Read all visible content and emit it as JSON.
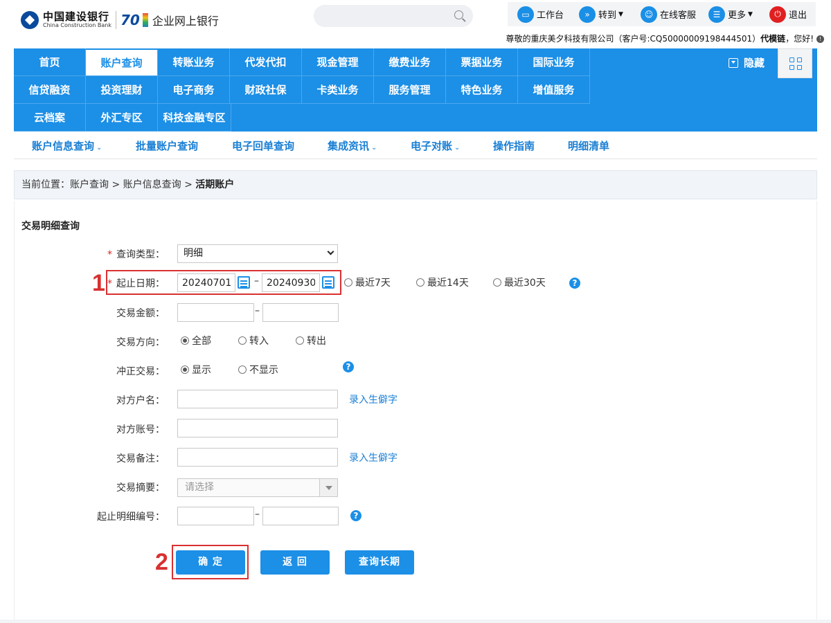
{
  "header": {
    "logo_cn": "中国建设银行",
    "logo_en": "China Construction Bank",
    "logo_badge": "70",
    "product_name": "企业网上银行",
    "search_placeholder": "",
    "tools": [
      {
        "label": "工作台",
        "icon": "monitor-icon"
      },
      {
        "label": "转到",
        "icon": "forward-icon"
      },
      {
        "label": "在线客服",
        "icon": "user-icon"
      },
      {
        "label": "更多",
        "icon": "list-icon"
      },
      {
        "label": "退出",
        "icon": "power-icon"
      }
    ],
    "welcome_prefix": "尊敬的重庆美夕科技有限公司（客户号:CQ50000009198444501）",
    "welcome_name": "代模链",
    "welcome_suffix": "，您好!"
  },
  "nav": {
    "items": [
      "首页",
      "账户查询",
      "转账业务",
      "代发代扣",
      "现金管理",
      "缴费业务",
      "票据业务",
      "国际业务",
      "信贷融资",
      "投资理财",
      "电子商务",
      "财政社保",
      "卡类业务",
      "服务管理",
      "特色业务",
      "增值服务",
      "云档案",
      "外汇专区",
      "科技金融专区"
    ],
    "active": "账户查询",
    "hide_label": "隐藏"
  },
  "subnav": {
    "items": [
      {
        "label": "账户信息查询",
        "dropdown": true
      },
      {
        "label": "批量账户查询",
        "dropdown": false
      },
      {
        "label": "电子回单查询",
        "dropdown": false
      },
      {
        "label": "集成资讯",
        "dropdown": true
      },
      {
        "label": "电子对账",
        "dropdown": true
      },
      {
        "label": "操作指南",
        "dropdown": false
      },
      {
        "label": "明细清单",
        "dropdown": false
      }
    ]
  },
  "breadcrumb": {
    "prefix": "当前位置：账户查询 > 账户信息查询 > ",
    "current": "活期账户"
  },
  "form": {
    "title": "交易明细查询",
    "query_type_label": "查询类型：",
    "query_type_value": "明细",
    "date_label": "起止日期：",
    "date_start": "20240701",
    "date_end": "20240930",
    "date_sep": "–",
    "range_options": [
      "最近7天",
      "最近14天",
      "最近30天"
    ],
    "amount_label": "交易金额：",
    "direction_label": "交易方向：",
    "direction_options": [
      "全部",
      "转入",
      "转出"
    ],
    "direction_selected": "全部",
    "reversal_label": "冲正交易：",
    "reversal_options": [
      "显示",
      "不显示"
    ],
    "reversal_selected": "显示",
    "counterparty_name_label": "对方户名：",
    "counterparty_account_label": "对方账号：",
    "remark_label": "交易备注：",
    "rare_char_link": "录入生僻字",
    "summary_label": "交易摘要：",
    "summary_placeholder": "请选择",
    "detail_no_label": "起止明细编号：",
    "help_glyph": "?",
    "required_mark": "*"
  },
  "buttons": {
    "confirm": "确 定",
    "back": "返 回",
    "long_query": "查询长期"
  },
  "annotations": {
    "step1": "1",
    "step2": "2",
    "color": "#d93030"
  },
  "colors": {
    "primary": "#1c8fe6",
    "link": "#1a7fd4"
  }
}
